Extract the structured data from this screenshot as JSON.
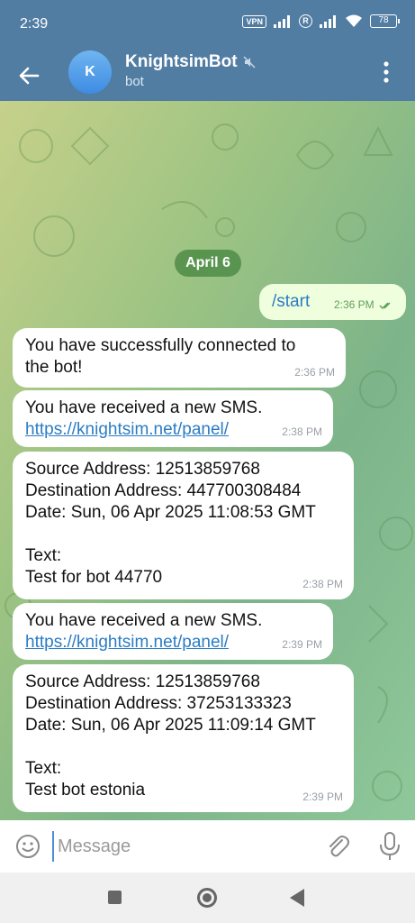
{
  "status_bar": {
    "time": "2:39",
    "vpn": "VPN",
    "roaming": "R",
    "battery": "78"
  },
  "header": {
    "avatar_letter": "K",
    "title": "KnightsimBot",
    "subtitle": "bot"
  },
  "chat": {
    "date_chip": "April 6",
    "outgoing": [
      {
        "text": "/start",
        "time": "2:36 PM"
      }
    ],
    "messages": [
      {
        "lines": [
          "You have successfully connected to",
          "the bot!"
        ],
        "time": "2:36 PM"
      },
      {
        "lines": [
          "You have received a new SMS."
        ],
        "link": "https://knightsim.net/panel/",
        "time": "2:38 PM"
      },
      {
        "lines": [
          "Source Address: 12513859768",
          "Destination Address: 447700308484",
          "Date: Sun, 06 Apr 2025 11:08:53 GMT",
          "",
          "Text:",
          "Test for bot 44770"
        ],
        "time": "2:38 PM"
      },
      {
        "lines": [
          "You have received a new SMS."
        ],
        "link": "https://knightsim.net/panel/",
        "time": "2:39 PM"
      },
      {
        "lines": [
          "Source Address: 12513859768",
          "Destination Address: 37253133323",
          "Date: Sun, 06 Apr 2025 11:09:14 GMT",
          "",
          "Text:",
          "Test bot estonia"
        ],
        "time": "2:39 PM"
      }
    ]
  },
  "input": {
    "placeholder": "Message"
  },
  "colors": {
    "header": "#527da3",
    "outgoing_bubble": "#effedd",
    "incoming_bubble": "#ffffff",
    "link": "#2b7cc4",
    "date_chip": "#4e8c46"
  }
}
